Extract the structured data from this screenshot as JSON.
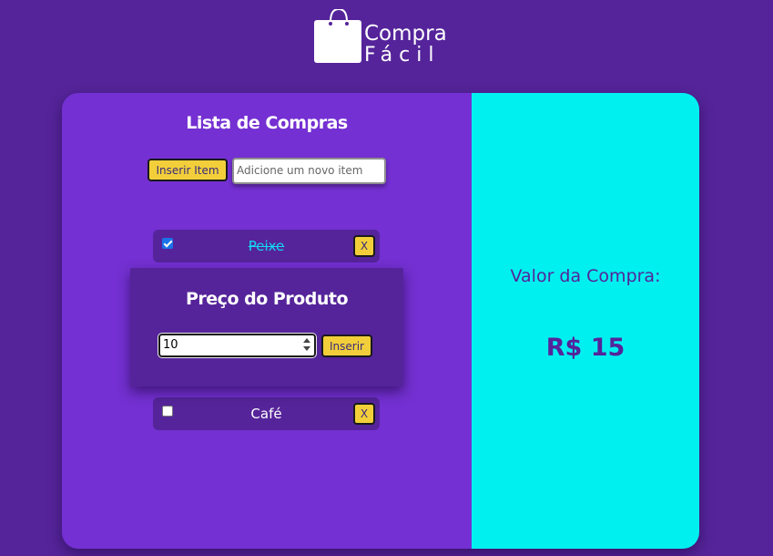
{
  "brand": {
    "line1": "Compra",
    "line2": "Fácil"
  },
  "list": {
    "title": "Lista de Compras",
    "add_button": "Inserir Item",
    "add_placeholder": "Adicione um novo item",
    "items": [
      {
        "name": "Peixe",
        "checked": true,
        "remove_label": "X"
      },
      {
        "name": "Café",
        "checked": false,
        "remove_label": "X"
      }
    ]
  },
  "price_modal": {
    "title": "Preço do Produto",
    "input_value": "10",
    "insert_button": "Inserir"
  },
  "summary": {
    "label": "Valor da Compra:",
    "value": "R$ 15"
  },
  "colors": {
    "background": "#55249a",
    "panel": "#7430d2",
    "summary_bg": "#00f0f0",
    "button": "#f2cf3a",
    "done_text": "#14d8f0"
  }
}
